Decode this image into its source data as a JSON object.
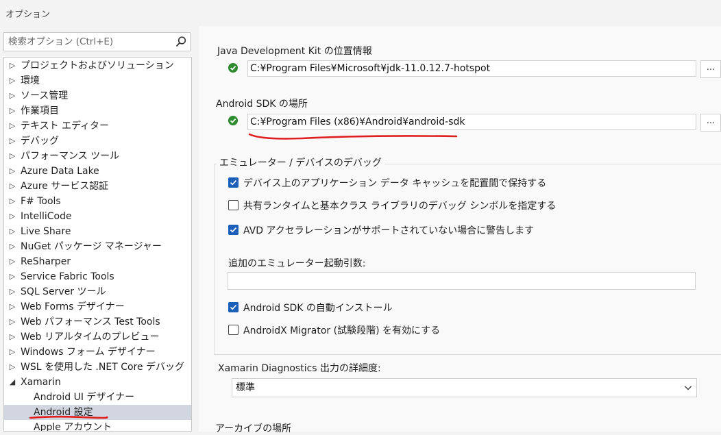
{
  "window": {
    "title": "オプション"
  },
  "search": {
    "placeholder": "検索オプション (Ctrl+E)"
  },
  "tree": [
    {
      "label": "プロジェクトおよびソリューション",
      "arrow": "▷"
    },
    {
      "label": "環境",
      "arrow": "▷"
    },
    {
      "label": "ソース管理",
      "arrow": "▷"
    },
    {
      "label": "作業項目",
      "arrow": "▷"
    },
    {
      "label": "テキスト エディター",
      "arrow": "▷"
    },
    {
      "label": "デバッグ",
      "arrow": "▷"
    },
    {
      "label": "パフォーマンス ツール",
      "arrow": "▷"
    },
    {
      "label": "Azure Data Lake",
      "arrow": "▷"
    },
    {
      "label": "Azure サービス認証",
      "arrow": "▷"
    },
    {
      "label": "F# Tools",
      "arrow": "▷"
    },
    {
      "label": "IntelliCode",
      "arrow": "▷"
    },
    {
      "label": "Live Share",
      "arrow": "▷"
    },
    {
      "label": "NuGet パッケージ マネージャー",
      "arrow": "▷"
    },
    {
      "label": "ReSharper",
      "arrow": "▷"
    },
    {
      "label": "Service Fabric Tools",
      "arrow": "▷"
    },
    {
      "label": "SQL Server ツール",
      "arrow": "▷"
    },
    {
      "label": "Web Forms デザイナー",
      "arrow": "▷"
    },
    {
      "label": "Web パフォーマンス Test Tools",
      "arrow": "▷"
    },
    {
      "label": "Web リアルタイムのプレビュー",
      "arrow": "▷"
    },
    {
      "label": "Windows フォーム デザイナー",
      "arrow": "▷"
    },
    {
      "label": "WSL を使用した .NET Core デバッグ",
      "arrow": "▷"
    },
    {
      "label": "Xamarin",
      "arrow": "◢"
    },
    {
      "label": "Android UI デザイナー",
      "arrow": ""
    },
    {
      "label": "Android 設定",
      "arrow": ""
    },
    {
      "label": "Apple アカウント",
      "arrow": ""
    }
  ],
  "jdk": {
    "label": "Java Development Kit の位置情報",
    "path": "C:¥Program Files¥Microsoft¥jdk-11.0.12.7-hotspot",
    "browse": "..."
  },
  "sdk": {
    "label": "Android SDK の場所",
    "path": "C:¥Program Files (x86)¥Android¥android-sdk",
    "browse": "..."
  },
  "emulator": {
    "title": "エミュレーター / デバイスのデバッグ",
    "options": [
      {
        "label": "デバイス上のアプリケーション データ キャッシュを配置間で保持する",
        "checked": true
      },
      {
        "label": "共有ランタイムと基本クラス ライブラリのデバッグ シンボルを指定する",
        "checked": false
      },
      {
        "label": "AVD アクセラレーションがサポートされていない場合に警告します",
        "checked": true
      }
    ],
    "args_label": "追加のエミュレーター起動引数:",
    "args_value": "",
    "options2": [
      {
        "label": "Android SDK の自動インストール",
        "checked": true
      },
      {
        "label": "AndroidX Migrator (試験段階) を有効にする",
        "checked": false
      }
    ]
  },
  "diagnostics": {
    "label": "Xamarin Diagnostics 出力の詳細度:",
    "value": "標準"
  },
  "archive": {
    "label": "アーカイブの場所"
  },
  "colors": {
    "annotation": "#e02020",
    "checkbox_on": "#1c5fb8",
    "status_ok": "#2e8b2e"
  }
}
